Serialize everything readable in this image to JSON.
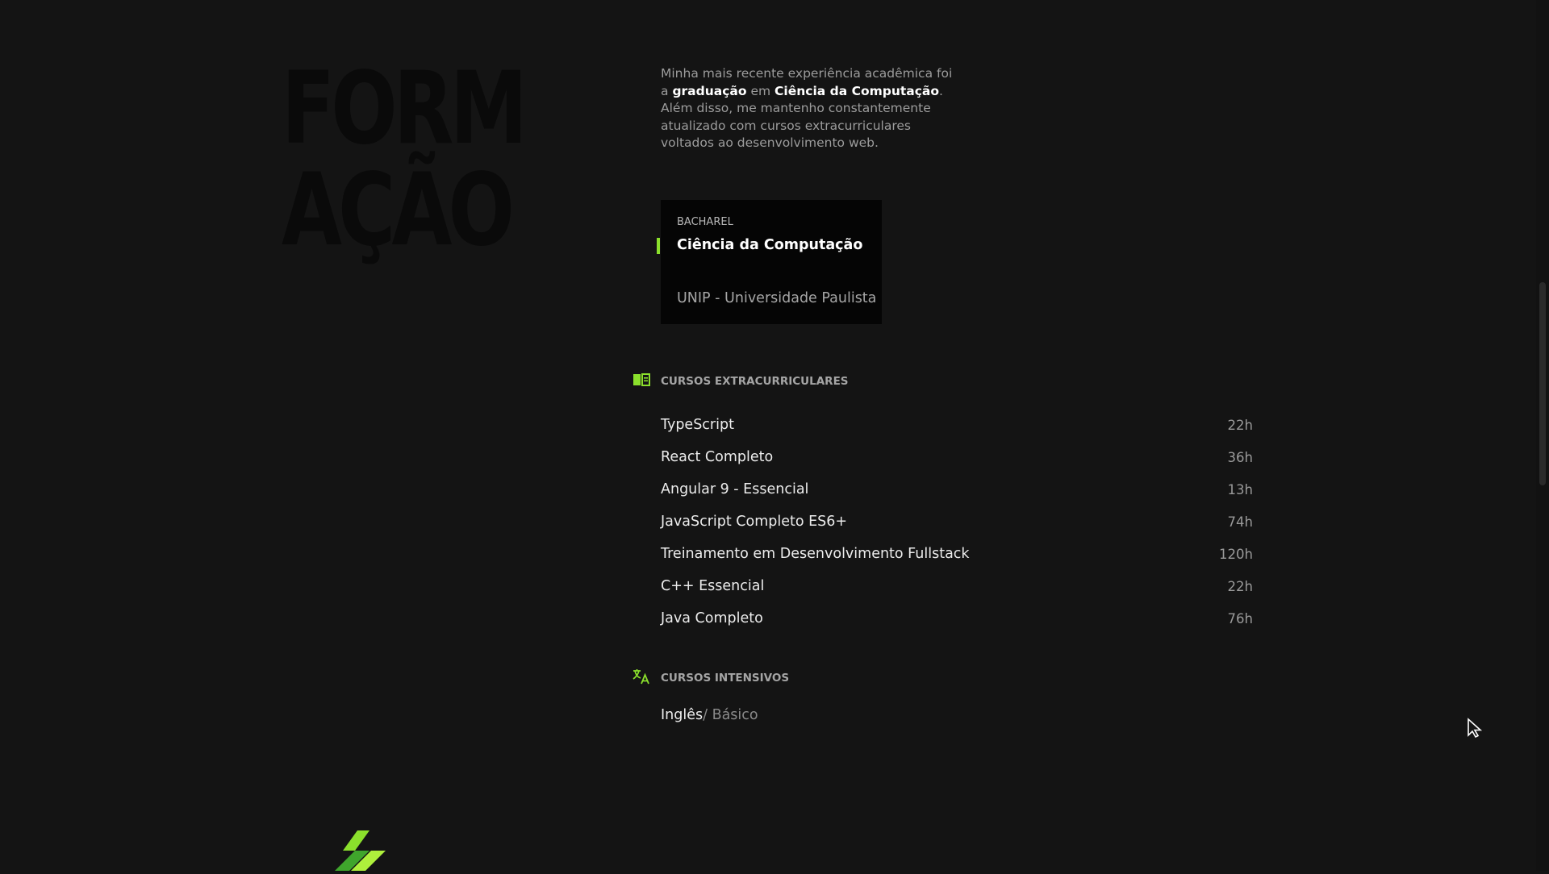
{
  "section": {
    "title_line1": "FORM",
    "title_line2": "AÇÃO"
  },
  "intro": {
    "part1": "Minha mais recente experiência acadêmica foi a ",
    "bold1": "graduação",
    "part2": " em ",
    "bold2": "Ciência da Computação",
    "part3": ". Além disso, me mantenho constantemente atualizado com cursos extracurriculares voltados ao desenvolvimento web."
  },
  "degree": {
    "type": "BACHAREL",
    "name": "Ciência da Computação",
    "school": "UNIP - Universidade Paulista"
  },
  "extracurricular": {
    "label": "CURSOS EXTRACURRICULARES",
    "icon": "book-icon",
    "courses": [
      {
        "name": "TypeScript",
        "hours": "22h"
      },
      {
        "name": "React Completo",
        "hours": "36h"
      },
      {
        "name": "Angular 9 - Essencial",
        "hours": "13h"
      },
      {
        "name": "JavaScript Completo ES6+",
        "hours": "74h"
      },
      {
        "name": "Treinamento em Desenvolvimento Fullstack",
        "hours": "120h"
      },
      {
        "name": "C++ Essencial",
        "hours": "22h"
      },
      {
        "name": "Java Completo",
        "hours": "76h"
      }
    ]
  },
  "intensive": {
    "label": "CURSOS INTENSIVOS",
    "icon": "translate-icon",
    "language": "Inglês",
    "level": "/ Básico"
  },
  "colors": {
    "background": "#141414",
    "accent": "#8be02c"
  }
}
